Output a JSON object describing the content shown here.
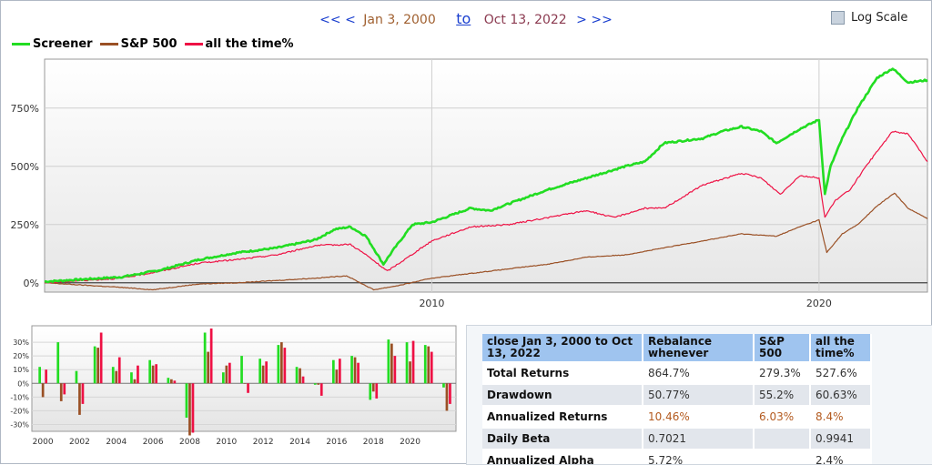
{
  "nav": {
    "prev": "<< <",
    "from_date": "Jan 3, 2000",
    "to_link": "to",
    "to_date": "Oct 13, 2022",
    "next": "> >>",
    "log_scale_label": "Log Scale"
  },
  "legend": [
    {
      "name": "Screener",
      "color": "#22dd22"
    },
    {
      "name": "S&P 500",
      "color": "#9a5025"
    },
    {
      "name": "all the time%",
      "color": "#ee1144"
    }
  ],
  "chart_data": [
    {
      "type": "line",
      "title": "",
      "x_ticks": [
        {
          "label": "2010",
          "x": 2010.0
        },
        {
          "label": "2020",
          "x": 2020.0
        }
      ],
      "y_ticks": [
        {
          "label": "0%",
          "y": 0
        },
        {
          "label": "250%",
          "y": 250
        },
        {
          "label": "500%",
          "y": 500
        },
        {
          "label": "750%",
          "y": 750
        }
      ],
      "xlim": [
        2000.0,
        2022.8
      ],
      "ylim": [
        -40,
        960
      ],
      "grid": true,
      "legend_position": "top-left",
      "series": [
        {
          "name": "Screener",
          "color": "#22dd22",
          "x": [
            2000.0,
            2001.0,
            2002.0,
            2003.0,
            2004.0,
            2005.0,
            2006.0,
            2007.0,
            2007.5,
            2007.9,
            2008.3,
            2008.75,
            2009.0,
            2009.5,
            2010.0,
            2011.0,
            2011.5,
            2012.0,
            2013.0,
            2014.0,
            2015.0,
            2015.5,
            2016.0,
            2017.0,
            2017.5,
            2018.0,
            2018.5,
            2018.9,
            2019.5,
            2020.0,
            2020.15,
            2020.3,
            2020.6,
            2021.0,
            2021.5,
            2021.9,
            2022.3,
            2022.8
          ],
          "y": [
            5,
            15,
            25,
            55,
            100,
            130,
            150,
            185,
            230,
            240,
            200,
            80,
            140,
            250,
            260,
            320,
            310,
            340,
            400,
            450,
            500,
            520,
            600,
            620,
            650,
            670,
            650,
            600,
            660,
            700,
            380,
            500,
            620,
            750,
            880,
            920,
            860,
            870
          ]
        },
        {
          "name": "S&P 500",
          "color": "#9a5025",
          "x": [
            2000.0,
            2001.0,
            2002.0,
            2002.8,
            2003.5,
            2004.0,
            2005.0,
            2006.0,
            2007.0,
            2007.8,
            2008.5,
            2009.2,
            2010.0,
            2011.0,
            2012.0,
            2013.0,
            2014.0,
            2015.0,
            2016.0,
            2017.0,
            2018.0,
            2018.9,
            2019.5,
            2020.0,
            2020.2,
            2020.6,
            2021.0,
            2021.5,
            2021.95,
            2022.3,
            2022.8
          ],
          "y": [
            0,
            -10,
            -20,
            -30,
            -15,
            -5,
            0,
            10,
            20,
            30,
            -30,
            -10,
            20,
            40,
            60,
            80,
            110,
            120,
            150,
            180,
            210,
            200,
            240,
            270,
            130,
            210,
            250,
            330,
            385,
            320,
            275
          ]
        },
        {
          "name": "all the time%",
          "color": "#ee1144",
          "x": [
            2000.0,
            2001.0,
            2002.0,
            2003.0,
            2004.0,
            2005.0,
            2006.0,
            2007.0,
            2007.9,
            2008.3,
            2008.85,
            2009.3,
            2010.0,
            2011.0,
            2012.0,
            2013.0,
            2014.0,
            2014.7,
            2015.5,
            2016.0,
            2017.0,
            2018.0,
            2018.5,
            2019.0,
            2019.5,
            2020.0,
            2020.15,
            2020.4,
            2020.8,
            2021.3,
            2021.9,
            2022.3,
            2022.8
          ],
          "y": [
            0,
            10,
            20,
            50,
            85,
            100,
            120,
            160,
            165,
            120,
            50,
            100,
            180,
            240,
            250,
            280,
            310,
            280,
            320,
            320,
            420,
            470,
            450,
            380,
            460,
            450,
            280,
            350,
            400,
            520,
            650,
            640,
            520
          ]
        }
      ]
    },
    {
      "type": "bar",
      "title": "",
      "x_ticks": [
        {
          "label": "2000",
          "x": 2000
        },
        {
          "label": "2002",
          "x": 2002
        },
        {
          "label": "2004",
          "x": 2004
        },
        {
          "label": "2006",
          "x": 2006
        },
        {
          "label": "2008",
          "x": 2008
        },
        {
          "label": "2010",
          "x": 2010
        },
        {
          "label": "2012",
          "x": 2012
        },
        {
          "label": "2014",
          "x": 2014
        },
        {
          "label": "2016",
          "x": 2016
        },
        {
          "label": "2018",
          "x": 2018
        },
        {
          "label": "2020",
          "x": 2020
        }
      ],
      "y_ticks": [
        {
          "label": "30%",
          "y": 30
        },
        {
          "label": "20%",
          "y": 20
        },
        {
          "label": "10%",
          "y": 10
        },
        {
          "label": "0%",
          "y": 0
        },
        {
          "label": "-10%",
          "y": -10
        },
        {
          "label": "-20%",
          "y": -20
        },
        {
          "label": "-30%",
          "y": -30
        }
      ],
      "ylim": [
        -35,
        42
      ],
      "categories": [
        "2000",
        "2001",
        "2002",
        "2003",
        "2004",
        "2005",
        "2006",
        "2007",
        "2008",
        "2009",
        "2010",
        "2011",
        "2012",
        "2013",
        "2014",
        "2015",
        "2016",
        "2017",
        "2018",
        "2019",
        "2020",
        "2021",
        "2022"
      ],
      "series": [
        {
          "name": "Screener",
          "color": "#22dd22",
          "values": [
            12,
            30,
            9,
            27,
            12,
            8,
            17,
            4,
            -25,
            37,
            8,
            20,
            18,
            28,
            12,
            -1,
            17,
            20,
            -12,
            32,
            30,
            28,
            -3
          ]
        },
        {
          "name": "S&P 500",
          "color": "#9a5025",
          "values": [
            -10,
            -13,
            -23,
            26,
            9,
            3,
            13,
            3,
            -38,
            23,
            13,
            0,
            13,
            30,
            11,
            -1,
            10,
            19,
            -6,
            29,
            16,
            27,
            -20
          ]
        },
        {
          "name": "all the time%",
          "color": "#ee1144",
          "values": [
            10,
            -8,
            -15,
            37,
            19,
            13,
            14,
            2,
            -36,
            40,
            15,
            -7,
            16,
            26,
            5,
            -9,
            18,
            15,
            -11,
            20,
            31,
            23,
            -15
          ]
        }
      ]
    }
  ],
  "stats": {
    "headers": [
      "close Jan 3, 2000 to Oct 13, 2022",
      "Rebalance whenever",
      "S&P 500",
      "all the time%"
    ],
    "rows": [
      {
        "label": "Total Returns",
        "c1": "864.7%",
        "c2": "279.3%",
        "c3": "527.6%",
        "brown": false
      },
      {
        "label": "Drawdown",
        "c1": "50.77%",
        "c2": "55.2%",
        "c3": "60.63%",
        "brown": false
      },
      {
        "label": "Annualized Returns",
        "c1": "10.46%",
        "c2": "6.03%",
        "c3": "8.4%",
        "brown": true
      },
      {
        "label": "Daily Beta",
        "c1": "0.7021",
        "c2": "",
        "c3": "0.9941",
        "brown": false
      },
      {
        "label": "Annualized Alpha",
        "c1": "5.72%",
        "c2": "",
        "c3": "2.4%",
        "brown": false
      }
    ]
  }
}
